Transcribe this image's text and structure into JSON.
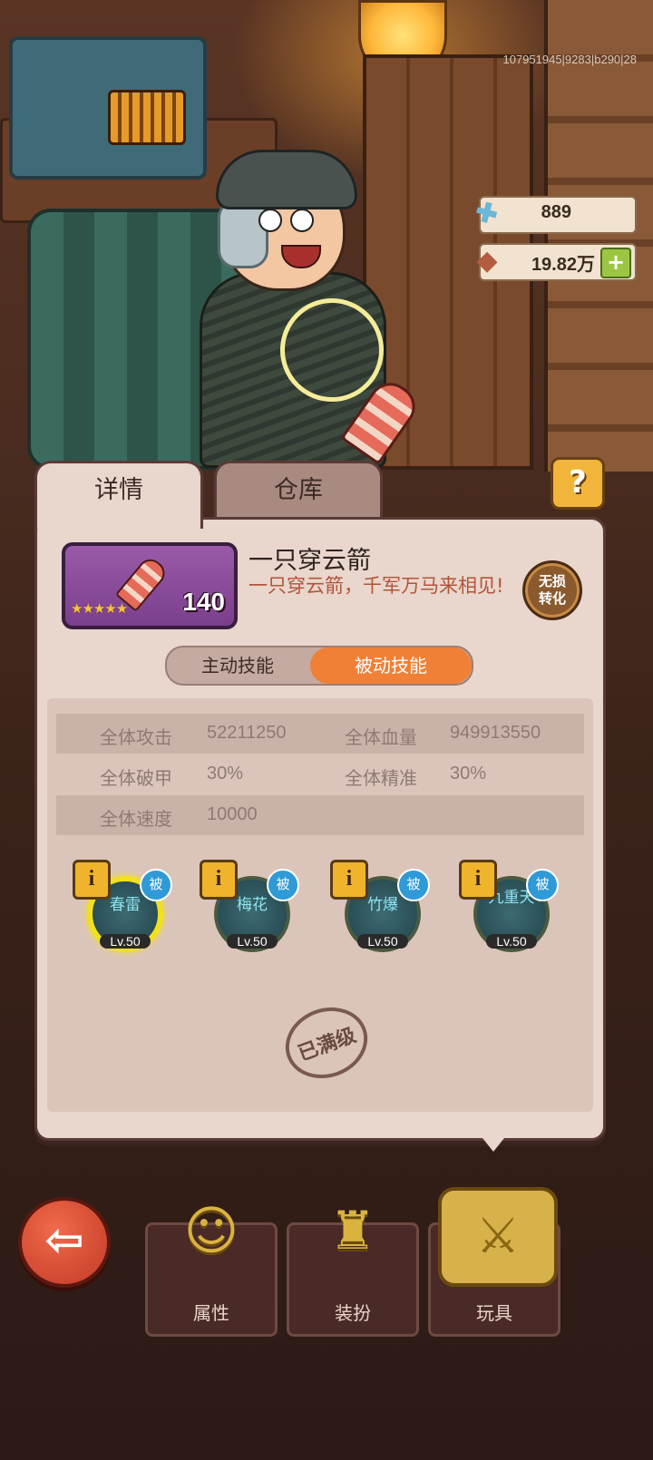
{
  "debug_info": "107951945|9283|b290|28",
  "resources": {
    "wrench": {
      "icon": "wrench-icon",
      "value": "889"
    },
    "coins": {
      "icon": "bag-icon",
      "value": "19.82万",
      "add_icon": "plus-icon"
    }
  },
  "tabs": {
    "detail": "详情",
    "storage": "仓库"
  },
  "help_label": "?",
  "item": {
    "name": "一只穿云箭",
    "description": "一只穿云箭，千军万马来相见!",
    "count": "140",
    "stars": "★★★★★",
    "convert_label": "无损转化"
  },
  "skill_tabs": {
    "active": "主动技能",
    "passive": "被动技能",
    "selected": "passive"
  },
  "stats": {
    "atk_label": "全体攻击",
    "atk_value": "52211250",
    "hp_label": "全体血量",
    "hp_value": "949913550",
    "armor_label": "全体破甲",
    "armor_value": "30%",
    "acc_label": "全体精准",
    "acc_value": "30%",
    "spd_label": "全体速度",
    "spd_value": "10000"
  },
  "skills": [
    {
      "name": "春雷",
      "level": "Lv.50",
      "badge": "被",
      "info": "i"
    },
    {
      "name": "梅花",
      "level": "Lv.50",
      "badge": "被",
      "info": "i"
    },
    {
      "name": "竹爆",
      "level": "Lv.50",
      "badge": "被",
      "info": "i"
    },
    {
      "name": "九重天",
      "level": "Lv.50",
      "badge": "被",
      "info": "i"
    }
  ],
  "maxed_label": "已满级",
  "back_icon": "arrow-left-icon",
  "nav": {
    "attributes": "属性",
    "outfit": "装扮",
    "toys": "玩具"
  },
  "colors": {
    "accent": "#f08036",
    "panel": "#e9d6cc",
    "gold": "#efb42c",
    "highlight": "#f2e01e"
  }
}
